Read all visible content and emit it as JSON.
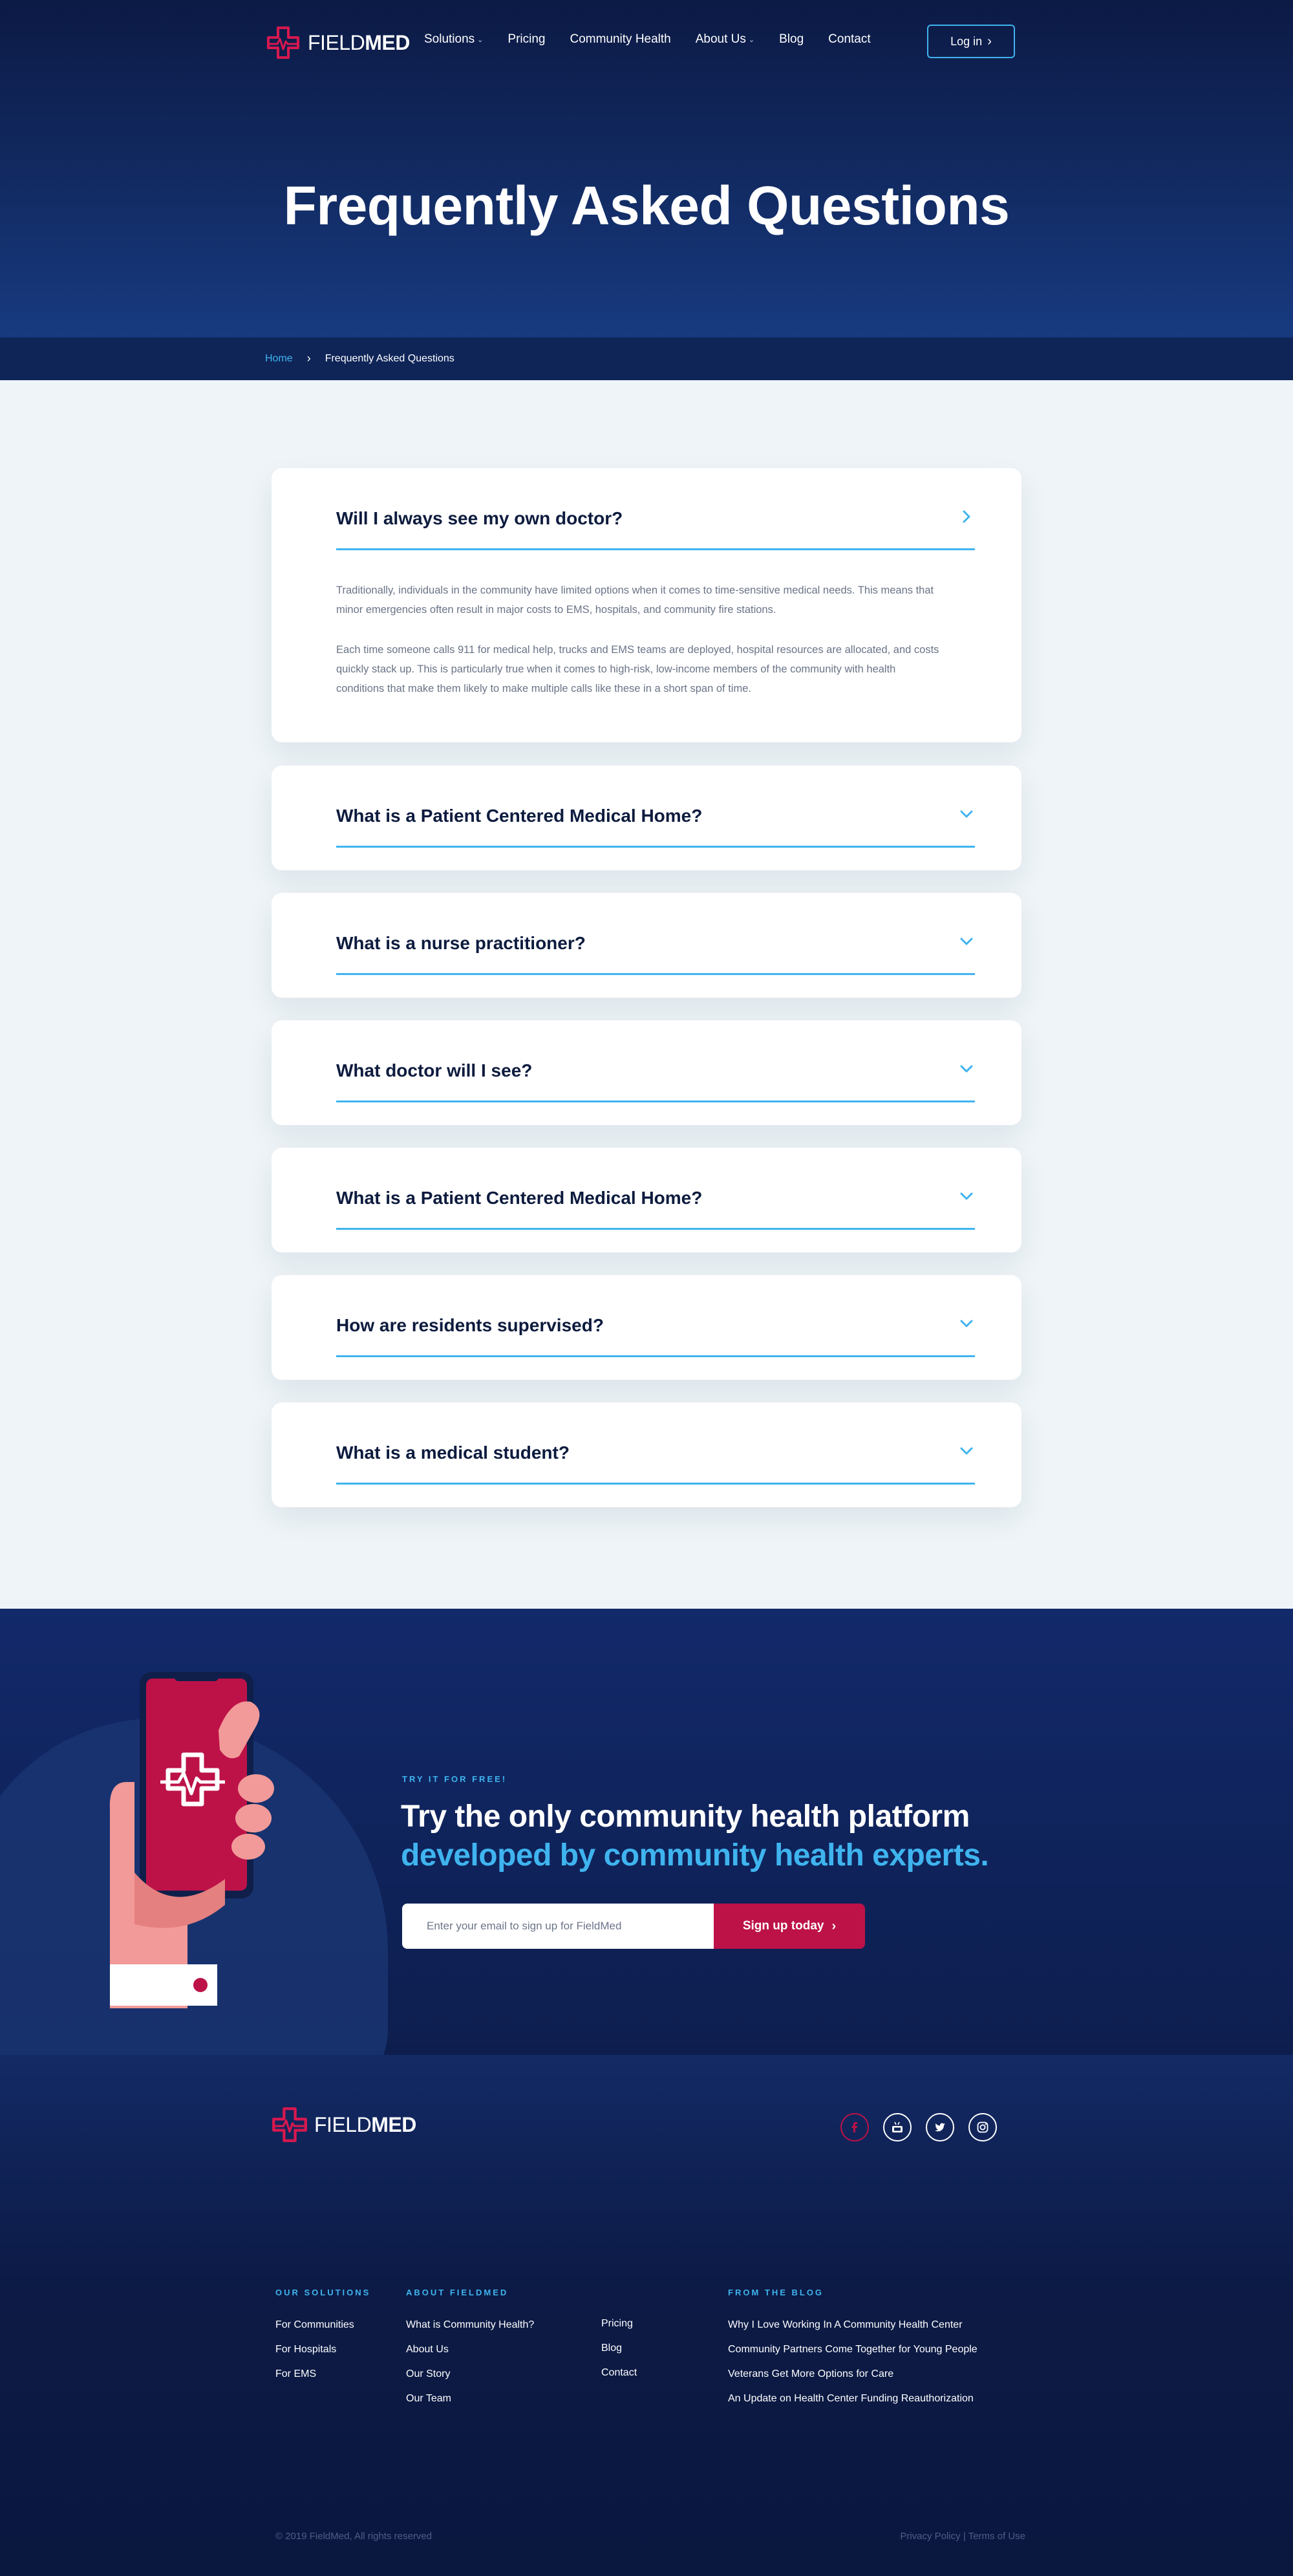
{
  "brand": {
    "name_light": "FIELD",
    "name_bold": "MED"
  },
  "nav": {
    "items": [
      {
        "label": "Solutions",
        "has_menu": true
      },
      {
        "label": "Pricing",
        "has_menu": false
      },
      {
        "label": "Community Health",
        "has_menu": false
      },
      {
        "label": "About Us",
        "has_menu": true
      },
      {
        "label": "Blog",
        "has_menu": false
      },
      {
        "label": "Contact",
        "has_menu": false
      }
    ],
    "login_label": "Log in"
  },
  "hero": {
    "title": "Frequently Asked Questions"
  },
  "breadcrumb": {
    "home": "Home",
    "separator": "›",
    "current": "Frequently Asked Questions"
  },
  "faq": {
    "items": [
      {
        "question": "Will I always see my own doctor?",
        "expanded": true,
        "answer": [
          "Traditionally, individuals in the community have limited options when it comes to time-sensitive medical needs. This means that minor emergencies often result in major costs to EMS, hospitals, and community fire stations.",
          "Each time someone calls 911 for medical help, trucks and EMS teams are deployed, hospital resources are allocated, and costs quickly stack up. This is particularly true when it comes to high-risk, low-income members of the community with health conditions that make them likely to make multiple calls like these in a short span of time."
        ]
      },
      {
        "question": "What is a Patient Centered Medical Home?",
        "expanded": false
      },
      {
        "question": "What is a nurse practitioner?",
        "expanded": false
      },
      {
        "question": "What doctor will I see?",
        "expanded": false
      },
      {
        "question": "What is a Patient Centered Medical Home?",
        "expanded": false
      },
      {
        "question": "How are residents supervised?",
        "expanded": false
      },
      {
        "question": "What is a medical student?",
        "expanded": false
      }
    ]
  },
  "cta": {
    "kicker": "TRY IT FOR FREE!",
    "headline_line1": "Try the only community health platform",
    "headline_line2": "developed by community health experts.",
    "email_placeholder": "Enter your email to sign up for FieldMed",
    "button_label": "Sign up today"
  },
  "footer": {
    "social": [
      "facebook-icon",
      "youtube-icon",
      "twitter-icon",
      "instagram-icon"
    ],
    "columns": {
      "solutions": {
        "heading": "OUR SOLUTIONS",
        "links": [
          "For Communities",
          "For Hospitals",
          "For EMS"
        ]
      },
      "about": {
        "heading": "ABOUT FIELDMED",
        "links": [
          "What is Community Health?",
          "About Us",
          "Our Story",
          "Our Team"
        ]
      },
      "more": {
        "links": [
          "Pricing",
          "Blog",
          "Contact"
        ]
      },
      "blog": {
        "heading": "FROM THE BLOG",
        "links": [
          "Why I Love Working In A Community Health Center",
          "Community Partners Come Together for Young People",
          "Veterans Get More Options for Care",
          "An Update on Health Center Funding Reauthorization"
        ]
      }
    },
    "copyright": "© 2019 FieldMed, All rights reserved",
    "legal": "Privacy Policy | Terms of Use"
  },
  "colors": {
    "navy": "#0c1a45",
    "accent_blue": "#3fb4ef",
    "brand_red": "#bd1248",
    "page_bg": "#eef4f7"
  }
}
